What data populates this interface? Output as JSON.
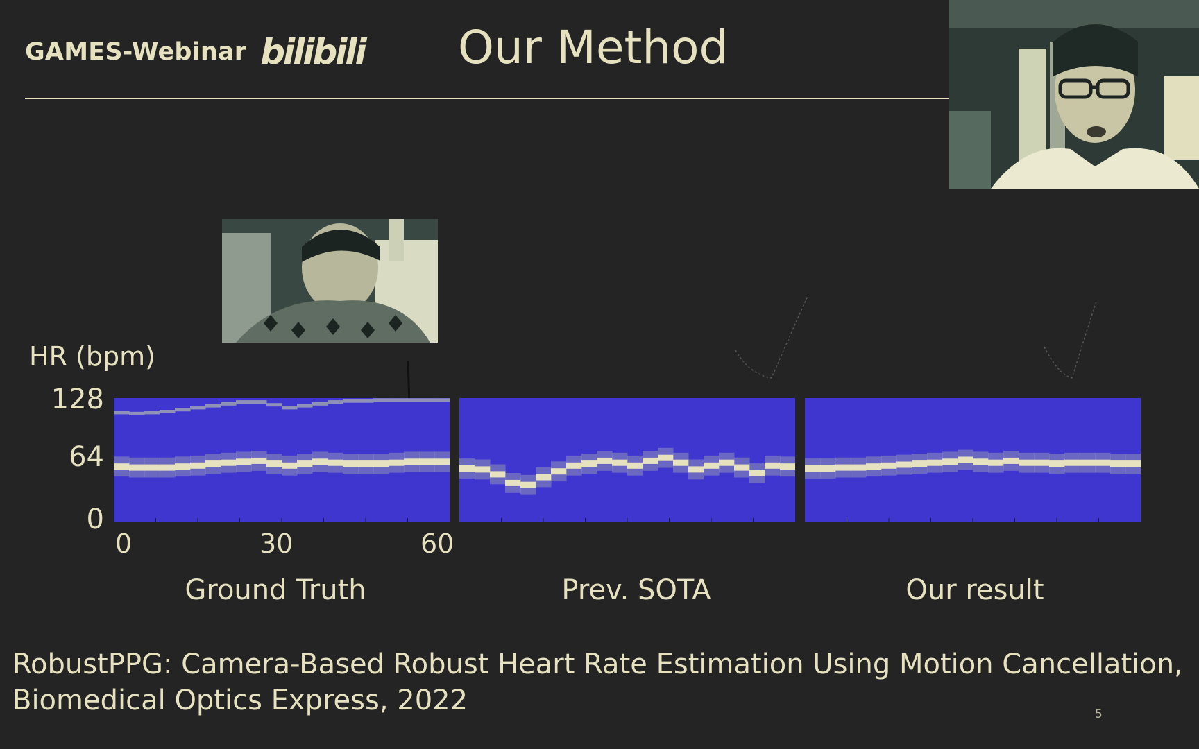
{
  "header": {
    "brand_text": "GAMES-Webinar",
    "brand_logo_text": "bilibili",
    "title": "Our Method"
  },
  "chart": {
    "ylabel": "HR (bpm)",
    "yticks": [
      "128",
      "64",
      "0"
    ],
    "xticks": [
      "0",
      "30",
      "60"
    ],
    "captions": [
      "Ground Truth",
      "Prev. SOTA",
      "Our result"
    ]
  },
  "chart_data": {
    "type": "heatmap",
    "ylabel": "HR (bpm)",
    "ylim": [
      0,
      128
    ],
    "xlim": [
      0,
      60
    ],
    "panels": [
      {
        "name": "Ground Truth",
        "main_track_bpm": [
          57,
          56,
          56,
          56,
          57,
          58,
          60,
          61,
          62,
          63,
          60,
          58,
          60,
          62,
          61,
          60,
          60,
          60,
          61,
          62,
          62,
          62
        ],
        "harmonic_track_bpm": [
          113,
          112,
          113,
          114,
          116,
          118,
          120,
          122,
          124,
          124,
          121,
          118,
          120,
          122,
          124,
          125,
          125,
          126,
          126,
          126,
          126,
          126
        ]
      },
      {
        "name": "Prev. SOTA",
        "main_track_bpm": [
          55,
          54,
          49,
          40,
          38,
          46,
          52,
          58,
          60,
          63,
          61,
          58,
          63,
          66,
          61,
          54,
          58,
          61,
          56,
          50,
          58,
          57
        ],
        "harmonic_track_bpm": []
      },
      {
        "name": "Our result",
        "main_track_bpm": [
          55,
          55,
          56,
          56,
          57,
          58,
          59,
          60,
          61,
          62,
          64,
          62,
          61,
          63,
          61,
          61,
          60,
          61,
          61,
          61,
          60,
          60
        ],
        "harmonic_track_bpm": []
      }
    ]
  },
  "citation": {
    "line1": "RobustPPG: Camera-Based Robust Heart Rate Estimation Using Motion Cancellation,",
    "line2": "Biomedical Optics Express, 2022"
  },
  "page_number": "5",
  "colors": {
    "background": "#242424",
    "text": "#e6e2bf",
    "heatmap_background": "#3f36d0",
    "heatmap_track": "#e6e2bf",
    "heatmap_mid": "#8f92b6"
  }
}
